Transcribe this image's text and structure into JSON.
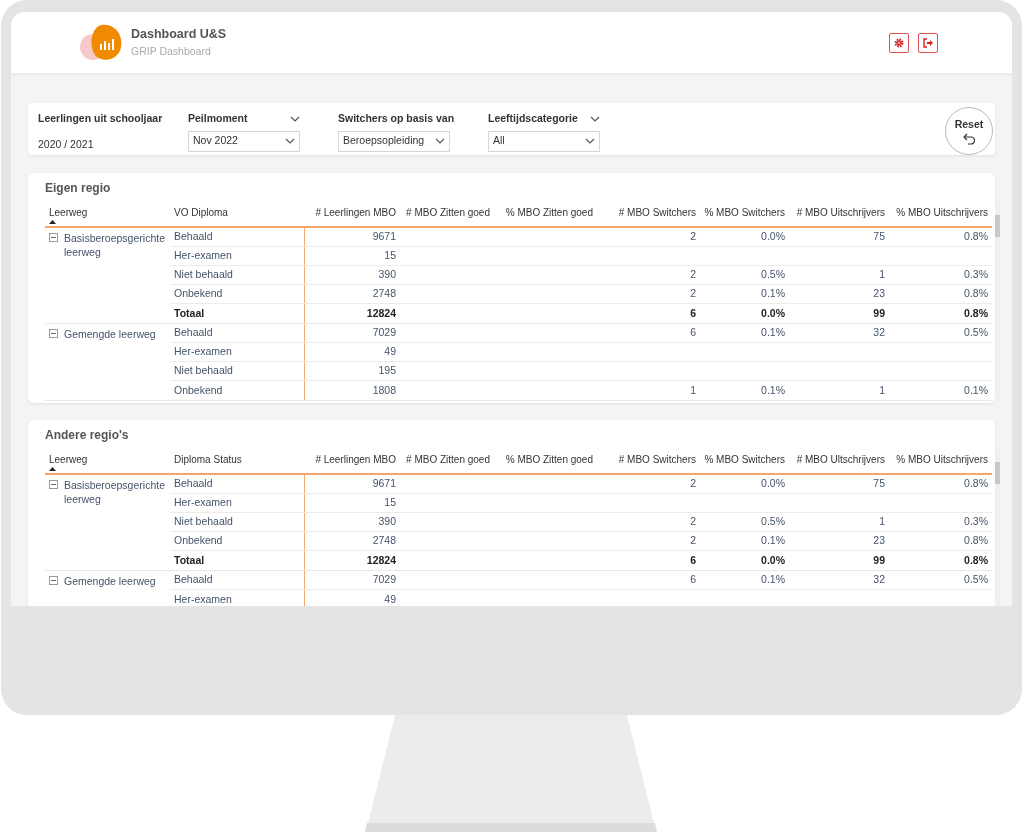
{
  "header": {
    "title": "Dashboard U&S",
    "subtitle": "GRIP Dashboard"
  },
  "filters": [
    {
      "kind": "static",
      "label": "Leerlingen uit schooljaar",
      "value": "2020 / 2021"
    },
    {
      "kind": "dropdown",
      "label": "Peilmoment",
      "value": "Nov 2022"
    },
    {
      "kind": "dropdown",
      "label": "Switchers op basis van",
      "value": "Beroepsopleiding"
    },
    {
      "kind": "dropdown",
      "label": "Leeftijdscategorie",
      "value": "All"
    }
  ],
  "reset": {
    "label": "Reset"
  },
  "tables": [
    {
      "title": "Eigen regio",
      "columns": [
        {
          "label": "Leerweg",
          "sorted": true
        },
        {
          "label": "VO Diploma",
          "sorted": false
        },
        {
          "label": "# Leerlingen MBO",
          "sorted": false
        },
        {
          "label": "# MBO Zitten goed",
          "sorted": false
        },
        {
          "label": "% MBO Zitten goed",
          "sorted": false
        },
        {
          "label": "# MBO Switchers",
          "sorted": false
        },
        {
          "label": "% MBO Switchers",
          "sorted": false
        },
        {
          "label": "# MBO Uitschrijvers",
          "sorted": false
        },
        {
          "label": "% MBO Uitschrijvers",
          "sorted": false
        }
      ],
      "groups": [
        {
          "label": "Basisberoepsgerichte leerweg",
          "expanded": true,
          "rows": [
            {
              "kind": "detail",
              "cells": [
                "Behaald",
                "9671",
                null,
                null,
                "2",
                "0.0%",
                "75",
                "0.8%"
              ]
            },
            {
              "kind": "detail",
              "cells": [
                "Her-examen",
                "15",
                null,
                null,
                null,
                null,
                null,
                null
              ]
            },
            {
              "kind": "detail",
              "cells": [
                "Niet behaald",
                "390",
                null,
                null,
                "2",
                "0.5%",
                "1",
                "0.3%"
              ]
            },
            {
              "kind": "detail",
              "cells": [
                "Onbekend",
                "2748",
                null,
                null,
                "2",
                "0.1%",
                "23",
                "0.8%"
              ]
            },
            {
              "kind": "total",
              "cells": [
                "Totaal",
                "12824",
                null,
                null,
                "6",
                "0.0%",
                "99",
                "0.8%"
              ]
            }
          ]
        },
        {
          "label": "Gemengde leerweg",
          "expanded": true,
          "rows": [
            {
              "kind": "detail",
              "cells": [
                "Behaald",
                "7029",
                null,
                null,
                "6",
                "0.1%",
                "32",
                "0.5%"
              ]
            },
            {
              "kind": "detail",
              "cells": [
                "Her-examen",
                "49",
                null,
                null,
                null,
                null,
                null,
                null
              ]
            },
            {
              "kind": "detail",
              "cells": [
                "Niet behaald",
                "195",
                null,
                null,
                null,
                null,
                null,
                null
              ]
            },
            {
              "kind": "detail",
              "cells": [
                "Onbekend",
                "1808",
                null,
                null,
                "1",
                "0.1%",
                "1",
                "0.1%"
              ]
            }
          ]
        }
      ]
    },
    {
      "title": "Andere regio's",
      "columns": [
        {
          "label": "Leerweg",
          "sorted": true
        },
        {
          "label": "Diploma Status",
          "sorted": false
        },
        {
          "label": "# Leerlingen MBO",
          "sorted": false
        },
        {
          "label": "# MBO Zitten goed",
          "sorted": false
        },
        {
          "label": "% MBO Zitten goed",
          "sorted": false
        },
        {
          "label": "# MBO Switchers",
          "sorted": false
        },
        {
          "label": "% MBO Switchers",
          "sorted": false
        },
        {
          "label": "# MBO Ultschrijvers",
          "sorted": false
        },
        {
          "label": "% MBO Uitschrijvers",
          "sorted": false
        }
      ],
      "groups": [
        {
          "label": "Basisberoepsgerichte leerweg",
          "expanded": true,
          "rows": [
            {
              "kind": "detail",
              "cells": [
                "Behaald",
                "9671",
                null,
                null,
                "2",
                "0.0%",
                "75",
                "0.8%"
              ]
            },
            {
              "kind": "detail",
              "cells": [
                "Her-examen",
                "15",
                null,
                null,
                null,
                null,
                null,
                null
              ]
            },
            {
              "kind": "detail",
              "cells": [
                "Niet behaald",
                "390",
                null,
                null,
                "2",
                "0.5%",
                "1",
                "0.3%"
              ]
            },
            {
              "kind": "detail",
              "cells": [
                "Onbekend",
                "2748",
                null,
                null,
                "2",
                "0.1%",
                "23",
                "0.8%"
              ]
            },
            {
              "kind": "total",
              "cells": [
                "Totaal",
                "12824",
                null,
                null,
                "6",
                "0.0%",
                "99",
                "0.8%"
              ]
            }
          ]
        },
        {
          "label": "Gemengde leerweg",
          "expanded": true,
          "rows": [
            {
              "kind": "detail",
              "cells": [
                "Behaald",
                "7029",
                null,
                null,
                "6",
                "0.1%",
                "32",
                "0.5%"
              ]
            },
            {
              "kind": "detail",
              "cells": [
                "Her-examen",
                "49",
                null,
                null,
                null,
                null,
                null,
                null
              ]
            }
          ]
        }
      ]
    }
  ]
}
